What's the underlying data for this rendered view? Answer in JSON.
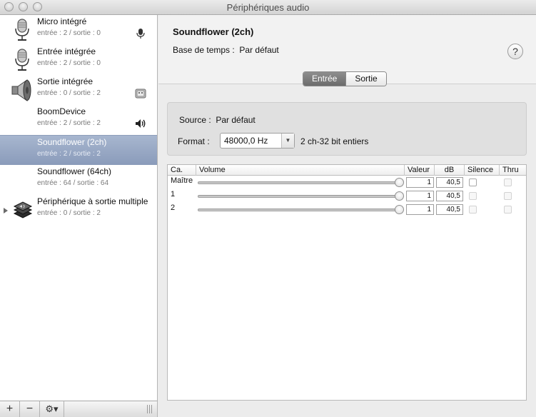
{
  "window": {
    "title": "Périphériques audio"
  },
  "devices": [
    {
      "name": "Micro intégré",
      "io": "entrée : 2 / sortie : 0",
      "icon": "microphone-icon",
      "badge": "mic-badge-icon",
      "selected": false
    },
    {
      "name": "Entrée intégrée",
      "io": "entrée : 2 / sortie : 0",
      "icon": "microphone-icon",
      "badge": "",
      "selected": false
    },
    {
      "name": "Sortie intégrée",
      "io": "entrée : 0 / sortie : 2",
      "icon": "speaker-icon",
      "badge": "finder-badge-icon",
      "selected": false
    },
    {
      "name": "BoomDevice",
      "io": "entrée : 2 / sortie : 2",
      "icon": "",
      "badge": "volume-badge-icon",
      "selected": false
    },
    {
      "name": "Soundflower (2ch)",
      "io": "entrée : 2 / sortie : 2",
      "icon": "",
      "badge": "",
      "selected": true
    },
    {
      "name": "Soundflower (64ch)",
      "io": "entrée : 64 / sortie : 64",
      "icon": "",
      "badge": "",
      "selected": false
    },
    {
      "name": "Périphérique à sortie multiple",
      "io": "entrée : 0 / sortie : 2",
      "icon": "multi-output-icon",
      "badge": "",
      "selected": false
    }
  ],
  "bottombar": {
    "add": "+",
    "remove": "−",
    "gear": "⚙▾"
  },
  "detail": {
    "title": "Soundflower (2ch)",
    "clock_label": "Base de temps :",
    "clock_value": "Par défaut",
    "help": "?",
    "tabs": [
      {
        "label": "Entrée",
        "active": true
      },
      {
        "label": "Sortie",
        "active": false
      }
    ],
    "source_label": "Source :",
    "source_value": "Par défaut",
    "format_label": "Format :",
    "format_value": "48000,0 Hz",
    "format_desc": "2 ch-32 bit entiers"
  },
  "table": {
    "headers": [
      "Ca.",
      "Volume",
      "Valeur",
      "dB",
      "Silence",
      "Thru"
    ],
    "rows": [
      {
        "channel": "Maître",
        "volume": 1.0,
        "value": "1",
        "db": "40,5",
        "silence": false,
        "thru": false
      },
      {
        "channel": "1",
        "volume": 1.0,
        "value": "1",
        "db": "40,5",
        "silence": false,
        "thru": false
      },
      {
        "channel": "2",
        "volume": 1.0,
        "value": "1",
        "db": "40,5",
        "silence": false,
        "thru": false
      }
    ]
  },
  "colors": {
    "selection": "#8c9dbb",
    "segment_active": "#7a7a7a"
  }
}
